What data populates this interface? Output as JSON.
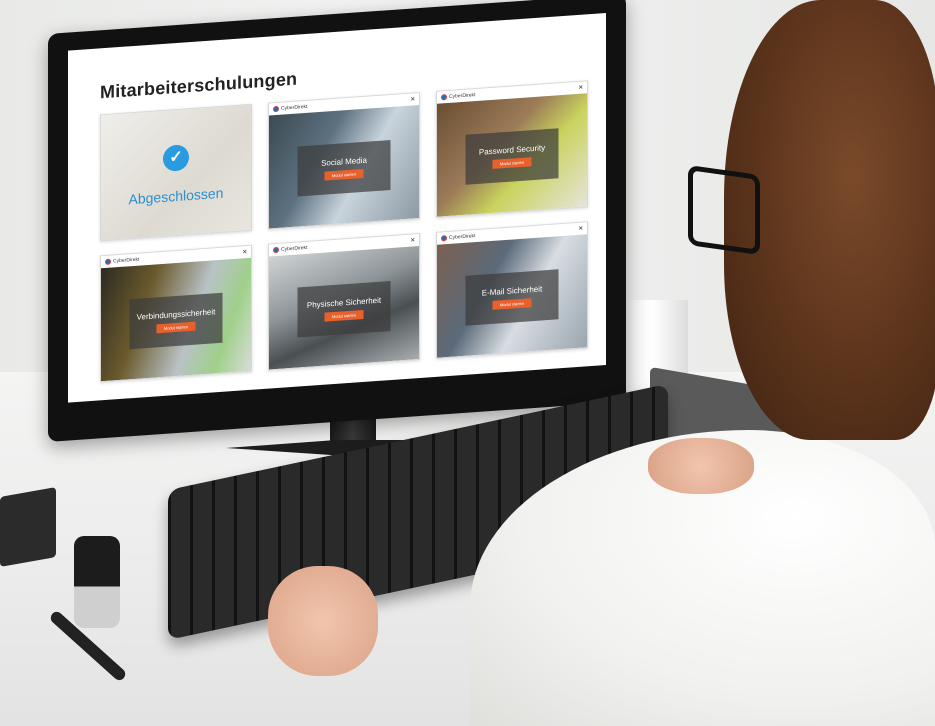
{
  "screen": {
    "title": "Mitarbeiterschulungen",
    "courses": [
      {
        "status": "completed",
        "label": "Abgeschlossen"
      },
      {
        "label": "Social Media",
        "button": "Modul starten",
        "brand": "CyberDirekt"
      },
      {
        "label": "Password Security",
        "button": "Modul starten",
        "brand": "CyberDirekt"
      },
      {
        "label": "Verbindungssicherheit",
        "button": "Modul starten",
        "brand": "CyberDirekt"
      },
      {
        "label": "Physische Sicherheit",
        "button": "Modul starten",
        "brand": "CyberDirekt"
      },
      {
        "label": "E-Mail Sicherheit",
        "button": "Modul starten",
        "brand": "CyberDirekt"
      }
    ],
    "close_glyph": "×",
    "check_glyph": "✓"
  },
  "colors": {
    "accent_orange": "#e8602c",
    "check_blue": "#2a9be0",
    "logo_blue": "#1d6fb8"
  },
  "icons": [
    "check-icon",
    "close-icon",
    "cyberdirekt-logo-icon"
  ]
}
